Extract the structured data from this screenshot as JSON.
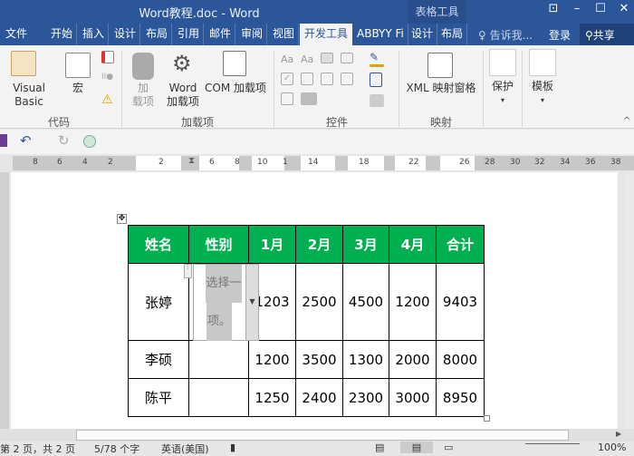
{
  "title": "Word教程.doc - Word",
  "context_group": "表格工具",
  "tabs": [
    "文件",
    "开始",
    "插入",
    "设计",
    "布局",
    "引用",
    "邮件",
    "审阅",
    "视图",
    "开发工具",
    "ABBYY Fi",
    "设计",
    "布局"
  ],
  "active_tab": "开发工具",
  "tell_me": "告诉我...",
  "login": "登录",
  "share": "共享",
  "ribbon": {
    "code": {
      "label": "代码",
      "visual_basic": "Visual Basic",
      "macro": "宏"
    },
    "addins": {
      "label": "加载项",
      "addins_line1": "加",
      "addins_line2": "载项",
      "word_line1": "Word",
      "word_line2": "加载项",
      "com": "COM 加载项"
    },
    "controls": {
      "label": "控件"
    },
    "mapping": {
      "label": "映射",
      "xml": "XML 映射窗格"
    },
    "protect": "保护",
    "template": "模板"
  },
  "ruler": [
    "8",
    "6",
    "4",
    "2",
    "2",
    "6",
    "8",
    "10",
    "1",
    "14",
    "18",
    "22",
    "26",
    "28",
    "30",
    "32",
    "34",
    "36",
    "38"
  ],
  "table": {
    "headers": [
      "姓名",
      "性别",
      "1月",
      "2月",
      "3月",
      "4月",
      "合计"
    ],
    "rows": [
      [
        "张婷",
        "",
        "1203",
        "2500",
        "4500",
        "1200",
        "9403"
      ],
      [
        "李硕",
        "",
        "1200",
        "3500",
        "1300",
        "2000",
        "8000"
      ],
      [
        "陈平",
        "",
        "1250",
        "2400",
        "2300",
        "3000",
        "8950"
      ]
    ],
    "dropdown_placeholder_1": "选择一",
    "dropdown_placeholder_2": "项。"
  },
  "status": {
    "page": "第 2 页，共 2 页",
    "words": "5/78 个字",
    "language": "英语(美国)",
    "zoom": "100%"
  },
  "colors": {
    "title_blue": "#2b579a",
    "header_green": "#00b050"
  }
}
